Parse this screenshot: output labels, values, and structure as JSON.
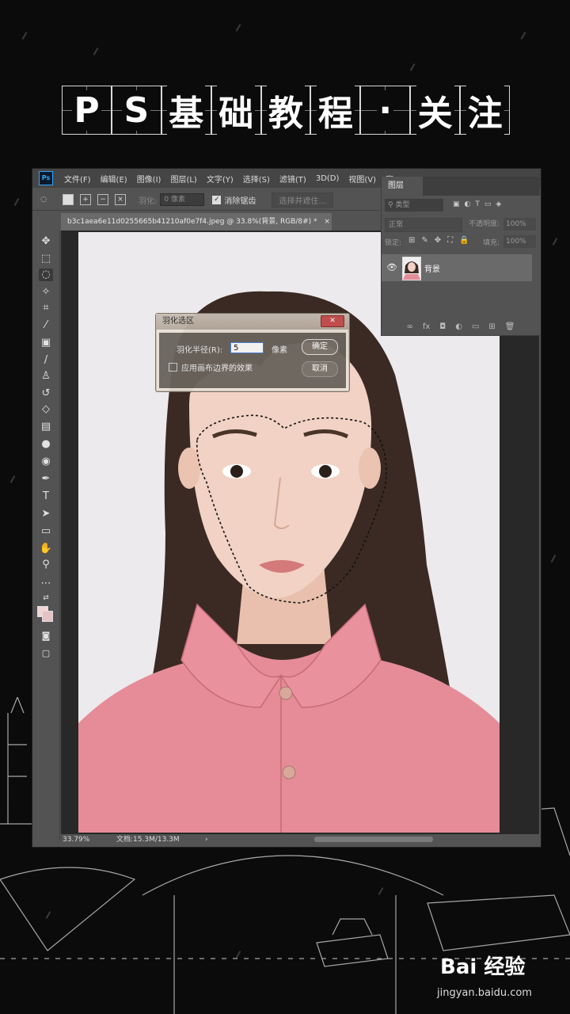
{
  "banner": {
    "chars": [
      "P",
      "S",
      "基",
      "础",
      "教",
      "程",
      "·",
      "关",
      "注"
    ]
  },
  "ps": {
    "logo": "Ps",
    "menu": [
      "文件(F)",
      "编辑(E)",
      "图像(I)",
      "图层(L)",
      "文字(Y)",
      "选择(S)",
      "滤镜(T)",
      "3D(D)",
      "视图(V)",
      "窗"
    ],
    "options": {
      "feather_label": "羽化:",
      "feather_value": "0 像素",
      "antialias_label": "消除锯齿",
      "select_mask_btn": "选择并遮住..."
    },
    "doc_tab": "b3c1aea6e11d0255665b41210af0e7f4.jpeg @ 33.8%(背景, RGB/8#) *",
    "doc_close": "×",
    "status": {
      "zoom": "33.79%",
      "doc_size": "文档:15.3M/13.3M"
    },
    "layers_panel": {
      "tab": "图层",
      "filter": "类型",
      "blend_mode": "正常",
      "opacity_label": "不透明度:",
      "opacity_value": "100%",
      "lock_label": "锁定:",
      "fill_label": "填充:",
      "fill_value": "100%",
      "layer_name": "背景",
      "footer_icons": [
        "link-icon",
        "fx-icon",
        "mask-icon",
        "adjustment-icon",
        "group-icon",
        "new-layer-icon",
        "trash-icon"
      ],
      "footer_glyphs": [
        "∞",
        "fx",
        "◘",
        "◐",
        "▭",
        "⊞",
        "🗑"
      ]
    }
  },
  "dialog": {
    "title": "羽化选区",
    "close": "✕",
    "radius_label": "羽化半径(R):",
    "radius_value": "5",
    "unit": "像素",
    "checkbox_label": "应用画布边界的效果",
    "ok": "确定",
    "cancel": "取消"
  },
  "watermark": {
    "brand": "Bai 经验",
    "url": "jingyan.baidu.com"
  },
  "colors": {
    "ps_bg": "#535353",
    "canvas": "#282828",
    "shirt": "#e58c98",
    "skin": "#f1d2c4",
    "hair": "#3a2a23"
  }
}
